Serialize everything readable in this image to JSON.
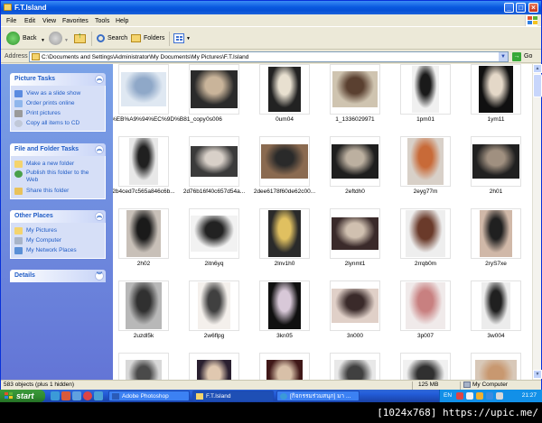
{
  "window": {
    "title": "F.T.Island"
  },
  "menu": [
    "File",
    "Edit",
    "View",
    "Favorites",
    "Tools",
    "Help"
  ],
  "toolbar": {
    "back_label": "Back",
    "search_label": "Search",
    "folders_label": "Folders"
  },
  "address": {
    "label": "Address",
    "path": "C:\\Documents and Settings\\Administrator\\My Documents\\My Pictures\\F.T.Island",
    "go_label": "Go"
  },
  "sidebar": {
    "picture_tasks": {
      "title": "Picture Tasks",
      "items": [
        "View as a slide show",
        "Order prints online",
        "Print pictures",
        "Copy all items to CD"
      ]
    },
    "file_folder_tasks": {
      "title": "File and Folder Tasks",
      "items": [
        "Make a new folder",
        "Publish this folder to the Web",
        "Share this folder"
      ]
    },
    "other_places": {
      "title": "Other Places",
      "items": [
        "My Pictures",
        "My Computer",
        "My Network Places"
      ]
    },
    "details": {
      "title": "Details"
    }
  },
  "files": [
    {
      "name": "%EB%A9%94%EC%9D%B81_copy"
    },
    {
      "name": "0s006"
    },
    {
      "name": "0um04"
    },
    {
      "name": "1_1336029971"
    },
    {
      "name": "1pm01"
    },
    {
      "name": "1ym11"
    },
    {
      "name": "2b4ced7c565a846c6b..."
    },
    {
      "name": "2d76b16f40c657d54a..."
    },
    {
      "name": "2dee6178f60de62c00..."
    },
    {
      "name": "2eftdh0"
    },
    {
      "name": "2eyg77m"
    },
    {
      "name": "2h01"
    },
    {
      "name": "2h02"
    },
    {
      "name": "2itn6yq"
    },
    {
      "name": "2lnv1h0"
    },
    {
      "name": "2lynmt1"
    },
    {
      "name": "2rrqb0m"
    },
    {
      "name": "2ryS7xe"
    },
    {
      "name": "2uzdl5k"
    },
    {
      "name": "2w6flpg"
    },
    {
      "name": "3kn05"
    },
    {
      "name": "3n000"
    },
    {
      "name": "3p007"
    },
    {
      "name": "3w004"
    },
    {
      "name": ""
    },
    {
      "name": ""
    },
    {
      "name": ""
    },
    {
      "name": ""
    },
    {
      "name": ""
    },
    {
      "name": ""
    }
  ],
  "status": {
    "objects": "583 objects (plus 1 hidden)",
    "size": "125 MB",
    "location": "My Computer"
  },
  "taskbar": {
    "start_label": "start",
    "tasks": [
      "Adobe Photoshop",
      "F.T.Island",
      "[กิจกรรมร่วมสนุก] มา ..."
    ],
    "language": "EN",
    "clock": "21:27"
  },
  "footer": {
    "stamp": "[1024x768] https://upic.me/"
  },
  "colors": {
    "title_blue": "#0a5ae0",
    "sidebar_blue": "#6375d6",
    "start_green": "#2f8a2f"
  }
}
